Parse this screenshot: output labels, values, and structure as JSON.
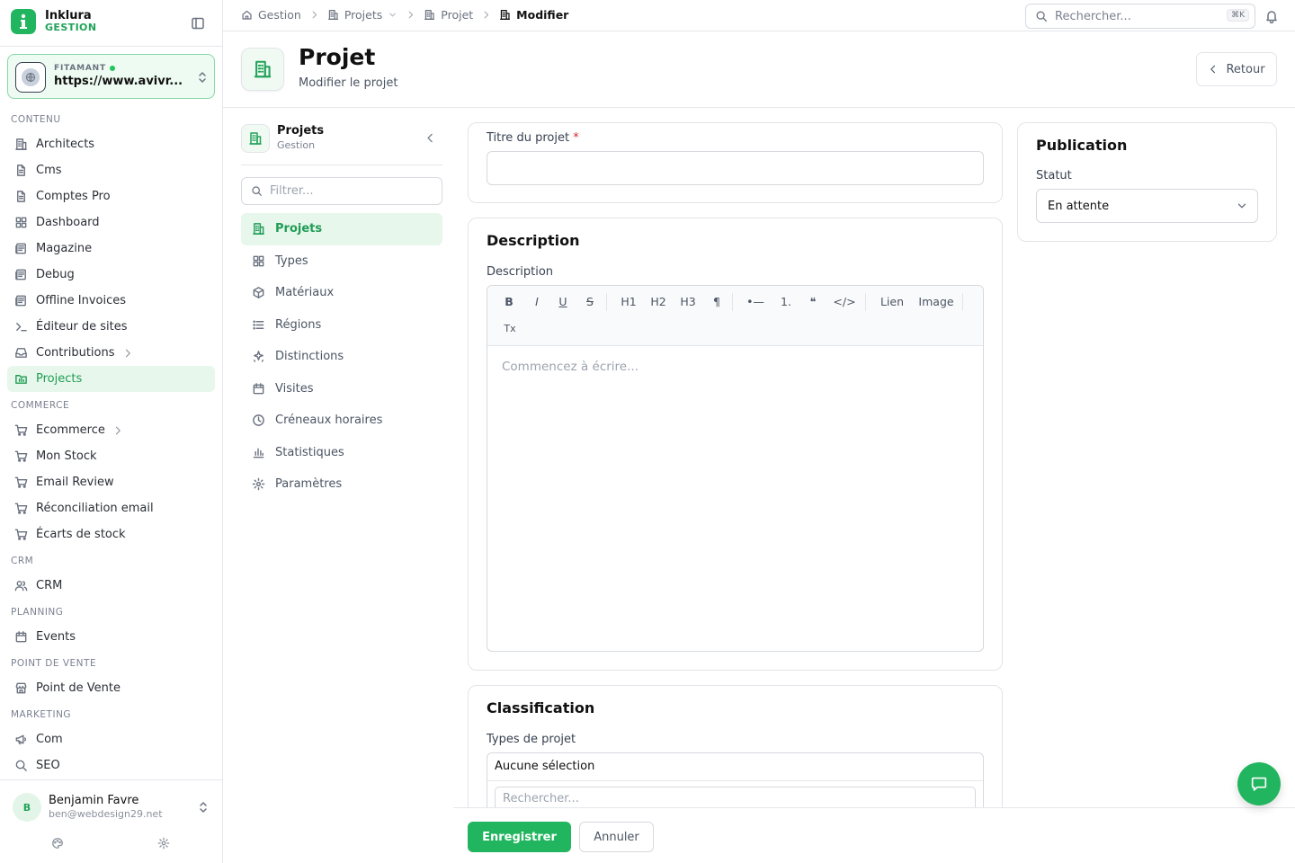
{
  "app": {
    "name": "Inklura",
    "subtitle": "GESTION",
    "brand_color": "#22b55f"
  },
  "site": {
    "label": "FITAMANT",
    "url": "https://www.avivr..."
  },
  "sidebar": {
    "sections": [
      {
        "title": "CONTENU",
        "items": [
          {
            "label": "Architects",
            "icon": "building-icon"
          },
          {
            "label": "Cms",
            "icon": "document-icon"
          },
          {
            "label": "Comptes Pro",
            "icon": "document-icon"
          },
          {
            "label": "Dashboard",
            "icon": "grid-icon"
          },
          {
            "label": "Magazine",
            "icon": "newspaper-icon"
          },
          {
            "label": "Debug",
            "icon": "newspaper-icon"
          },
          {
            "label": "Offline Invoices",
            "icon": "newspaper-icon"
          },
          {
            "label": "Éditeur de sites",
            "icon": "terminal-icon"
          },
          {
            "label": "Contributions",
            "icon": "inbox-icon",
            "has_children": true
          },
          {
            "label": "Projects",
            "icon": "projects-icon",
            "active": true
          }
        ]
      },
      {
        "title": "COMMERCE",
        "items": [
          {
            "label": "Ecommerce",
            "icon": "cart-icon",
            "has_children": true
          },
          {
            "label": "Mon Stock",
            "icon": "cart-icon"
          },
          {
            "label": "Email Review",
            "icon": "cart-icon"
          },
          {
            "label": "Réconciliation email",
            "icon": "cart-icon"
          },
          {
            "label": "Écarts de stock",
            "icon": "cart-icon"
          }
        ]
      },
      {
        "title": "CRM",
        "items": [
          {
            "label": "CRM",
            "icon": "users-icon"
          }
        ]
      },
      {
        "title": "PLANNING",
        "items": [
          {
            "label": "Events",
            "icon": "calendar-icon"
          }
        ]
      },
      {
        "title": "POINT DE VENTE",
        "items": [
          {
            "label": "Point de Vente",
            "icon": "store-icon"
          }
        ]
      },
      {
        "title": "MARKETING",
        "items": [
          {
            "label": "Com",
            "icon": "megaphone-icon"
          },
          {
            "label": "SEO",
            "icon": "search-icon"
          }
        ]
      }
    ]
  },
  "user": {
    "initial": "B",
    "name": "Benjamin Favre",
    "email": "ben@webdesign29.net"
  },
  "breadcrumbs": [
    {
      "label": "Gestion",
      "icon": "home-icon"
    },
    {
      "label": "Projets",
      "icon": "building-icon",
      "dropdown": true
    },
    {
      "label": "Projet",
      "icon": "building-icon"
    },
    {
      "label": "Modifier",
      "icon": "building-icon",
      "current": true
    }
  ],
  "search": {
    "placeholder": "Rechercher...",
    "shortcut": "⌘K"
  },
  "page": {
    "title": "Projet",
    "subtitle": "Modifier le projet",
    "back_label": "Retour"
  },
  "subnav": {
    "title": "Projets",
    "subtitle": "Gestion",
    "filter_placeholder": "Filtrer...",
    "items": [
      {
        "label": "Projets",
        "icon": "building-icon",
        "active": true
      },
      {
        "label": "Types",
        "icon": "grid-icon"
      },
      {
        "label": "Matériaux",
        "icon": "box-icon"
      },
      {
        "label": "Régions",
        "icon": "list-icon"
      },
      {
        "label": "Distinctions",
        "icon": "sparkles-icon"
      },
      {
        "label": "Visites",
        "icon": "calendar-icon"
      },
      {
        "label": "Créneaux horaires",
        "icon": "clock-icon"
      },
      {
        "label": "Statistiques",
        "icon": "bar-chart-icon"
      },
      {
        "label": "Paramètres",
        "icon": "gear-icon"
      }
    ]
  },
  "form": {
    "title_label": "Titre du projet",
    "title_required": "*",
    "title_value": "",
    "description_card_title": "Description",
    "description_label": "Description",
    "editor_toolbar": [
      "B",
      "I",
      "U",
      "S",
      "H1",
      "H2",
      "H3",
      "¶",
      "•—",
      "1.",
      "❝",
      "</>",
      "Lien",
      "Image",
      "Tx"
    ],
    "editor_placeholder": "Commencez à écrire...",
    "classification_title": "Classification",
    "types_label": "Types de projet",
    "types_value": "Aucune sélection",
    "types_search_placeholder": "Rechercher..."
  },
  "publication": {
    "title": "Publication",
    "status_label": "Statut",
    "status_value": "En attente"
  },
  "footer": {
    "save_label": "Enregistrer",
    "cancel_label": "Annuler"
  }
}
